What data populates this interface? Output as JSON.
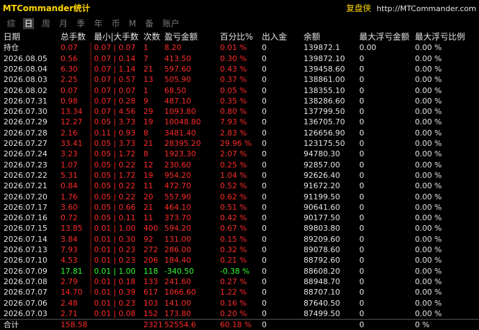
{
  "title": {
    "app": "MTCommander统计",
    "brand": "复盘侠",
    "site": "http://MTCommander.com"
  },
  "tabs": [
    "综",
    "日",
    "周",
    "月",
    "季",
    "年",
    "币",
    "M",
    "备",
    "账户"
  ],
  "active_tab": 1,
  "columns": [
    "日期",
    "总手数",
    "最小|大手数",
    "次数",
    "盈亏金额",
    "百分比%",
    "出入金",
    "余额",
    "最大浮亏金额",
    "最大浮亏比例"
  ],
  "holding": {
    "label": "持仓",
    "lots": "0.07",
    "minmax": "0.07 | 0.07",
    "count": "1",
    "pnl": "8.20",
    "pct": "0.01 %",
    "inout": "0",
    "balance": "139872.1",
    "maxfloat": "0.00",
    "maxfloat_pct": "0.00 %"
  },
  "rows": [
    {
      "date": "2026.08.05",
      "lots": "0.56",
      "minmax": "0.07 | 0.14",
      "count": "7",
      "pnl": "413.50",
      "pct": "0.30 %",
      "inout": "0",
      "balance": "139872.10",
      "maxfloat": "0",
      "maxfloat_pct": "0.00 %",
      "dir": "up"
    },
    {
      "date": "2026.08.04",
      "lots": "6.30",
      "minmax": "0.07 | 1.14",
      "count": "21",
      "pnl": "597.60",
      "pct": "0.43 %",
      "inout": "0",
      "balance": "139458.60",
      "maxfloat": "0",
      "maxfloat_pct": "0.00 %",
      "dir": "up"
    },
    {
      "date": "2026.08.03",
      "lots": "2.25",
      "minmax": "0.07 | 0.57",
      "count": "13",
      "pnl": "505.90",
      "pct": "0.37 %",
      "inout": "0",
      "balance": "138861.00",
      "maxfloat": "0",
      "maxfloat_pct": "0.00 %",
      "dir": "up"
    },
    {
      "date": "2026.08.02",
      "lots": "0.07",
      "minmax": "0.07 | 0.07",
      "count": "1",
      "pnl": "68.50",
      "pct": "0.05 %",
      "inout": "0",
      "balance": "138355.10",
      "maxfloat": "0",
      "maxfloat_pct": "0.00 %",
      "dir": "up"
    },
    {
      "date": "2026.07.31",
      "lots": "0.98",
      "minmax": "0.07 | 0.28",
      "count": "9",
      "pnl": "487.10",
      "pct": "0.35 %",
      "inout": "0",
      "balance": "138286.60",
      "maxfloat": "0",
      "maxfloat_pct": "0.00 %",
      "dir": "up"
    },
    {
      "date": "2026.07.30",
      "lots": "13.34",
      "minmax": "0.07 | 4.56",
      "count": "29",
      "pnl": "1093.80",
      "pct": "0.80 %",
      "inout": "0",
      "balance": "137799.50",
      "maxfloat": "0",
      "maxfloat_pct": "0.00 %",
      "dir": "up"
    },
    {
      "date": "2026.07.29",
      "lots": "12.27",
      "minmax": "0.05 | 3.73",
      "count": "19",
      "pnl": "10048.80",
      "pct": "7.93 %",
      "inout": "0",
      "balance": "136705.70",
      "maxfloat": "0",
      "maxfloat_pct": "0.00 %",
      "dir": "up"
    },
    {
      "date": "2026.07.28",
      "lots": "2.16",
      "minmax": "0.11 | 0.93",
      "count": "8",
      "pnl": "3481.40",
      "pct": "2.83 %",
      "inout": "0",
      "balance": "126656.90",
      "maxfloat": "0",
      "maxfloat_pct": "0.00 %",
      "dir": "up"
    },
    {
      "date": "2026.07.27",
      "lots": "33.41",
      "minmax": "0.05 | 3.73",
      "count": "21",
      "pnl": "28395.20",
      "pct": "29.96 %",
      "inout": "0",
      "balance": "123175.50",
      "maxfloat": "0",
      "maxfloat_pct": "0.00 %",
      "dir": "up"
    },
    {
      "date": "2026.07.24",
      "lots": "3.23",
      "minmax": "0.05 | 1.72",
      "count": "8",
      "pnl": "1923.30",
      "pct": "2.07 %",
      "inout": "0",
      "balance": "94780.30",
      "maxfloat": "0",
      "maxfloat_pct": "0.00 %",
      "dir": "up"
    },
    {
      "date": "2026.07.23",
      "lots": "1.07",
      "minmax": "0.05 | 0.22",
      "count": "12",
      "pnl": "230.60",
      "pct": "0.25 %",
      "inout": "0",
      "balance": "92857.00",
      "maxfloat": "0",
      "maxfloat_pct": "0.00 %",
      "dir": "up"
    },
    {
      "date": "2026.07.22",
      "lots": "5.31",
      "minmax": "0.05 | 1.72",
      "count": "19",
      "pnl": "954.20",
      "pct": "1.04 %",
      "inout": "0",
      "balance": "92626.40",
      "maxfloat": "0",
      "maxfloat_pct": "0.00 %",
      "dir": "up"
    },
    {
      "date": "2026.07.21",
      "lots": "0.84",
      "minmax": "0.05 | 0.22",
      "count": "11",
      "pnl": "472.70",
      "pct": "0.52 %",
      "inout": "0",
      "balance": "91672.20",
      "maxfloat": "0",
      "maxfloat_pct": "0.00 %",
      "dir": "up"
    },
    {
      "date": "2026.07.20",
      "lots": "1.76",
      "minmax": "0.05 | 0.22",
      "count": "20",
      "pnl": "557.90",
      "pct": "0.62 %",
      "inout": "0",
      "balance": "91199.50",
      "maxfloat": "0",
      "maxfloat_pct": "0.00 %",
      "dir": "up"
    },
    {
      "date": "2026.07.17",
      "lots": "3.60",
      "minmax": "0.05 | 0.66",
      "count": "21",
      "pnl": "464.10",
      "pct": "0.51 %",
      "inout": "0",
      "balance": "90641.60",
      "maxfloat": "0",
      "maxfloat_pct": "0.00 %",
      "dir": "up"
    },
    {
      "date": "2026.07.16",
      "lots": "0.72",
      "minmax": "0.05 | 0.11",
      "count": "11",
      "pnl": "373.70",
      "pct": "0.42 %",
      "inout": "0",
      "balance": "90177.50",
      "maxfloat": "0",
      "maxfloat_pct": "0.00 %",
      "dir": "up"
    },
    {
      "date": "2026.07.15",
      "lots": "13.85",
      "minmax": "0.01 | 1.00",
      "count": "400",
      "pnl": "594.20",
      "pct": "0.67 %",
      "inout": "0",
      "balance": "89803.80",
      "maxfloat": "0",
      "maxfloat_pct": "0.00 %",
      "dir": "up"
    },
    {
      "date": "2026.07.14",
      "lots": "3.84",
      "minmax": "0.01 | 0.30",
      "count": "92",
      "pnl": "131.00",
      "pct": "0.15 %",
      "inout": "0",
      "balance": "89209.60",
      "maxfloat": "0",
      "maxfloat_pct": "0.00 %",
      "dir": "up"
    },
    {
      "date": "2026.07.13",
      "lots": "7.93",
      "minmax": "0.01 | 0.23",
      "count": "272",
      "pnl": "286.00",
      "pct": "0.32 %",
      "inout": "0",
      "balance": "89078.60",
      "maxfloat": "0",
      "maxfloat_pct": "0.00 %",
      "dir": "up"
    },
    {
      "date": "2026.07.10",
      "lots": "4.53",
      "minmax": "0.01 | 0.23",
      "count": "206",
      "pnl": "184.40",
      "pct": "0.21 %",
      "inout": "0",
      "balance": "88792.60",
      "maxfloat": "0",
      "maxfloat_pct": "0.00 %",
      "dir": "up"
    },
    {
      "date": "2026.07.09",
      "lots": "17.81",
      "minmax": "0.01 | 1.00",
      "count": "118",
      "pnl": "-340.50",
      "pct": "-0.38 %",
      "inout": "0",
      "balance": "88608.20",
      "maxfloat": "0",
      "maxfloat_pct": "0.00 %",
      "dir": "down"
    },
    {
      "date": "2026.07.08",
      "lots": "2.79",
      "minmax": "0.01 | 0.18",
      "count": "133",
      "pnl": "241.60",
      "pct": "0.27 %",
      "inout": "0",
      "balance": "88948.70",
      "maxfloat": "0",
      "maxfloat_pct": "0.00 %",
      "dir": "up"
    },
    {
      "date": "2026.07.07",
      "lots": "14.70",
      "minmax": "0.01 | 0.39",
      "count": "617",
      "pnl": "1066.60",
      "pct": "1.22 %",
      "inout": "0",
      "balance": "88707.10",
      "maxfloat": "0",
      "maxfloat_pct": "0.00 %",
      "dir": "up"
    },
    {
      "date": "2026.07.06",
      "lots": "2.48",
      "minmax": "0.01 | 0.23",
      "count": "103",
      "pnl": "141.00",
      "pct": "0.16 %",
      "inout": "0",
      "balance": "87640.50",
      "maxfloat": "0",
      "maxfloat_pct": "0.00 %",
      "dir": "up"
    },
    {
      "date": "2026.07.03",
      "lots": "2.71",
      "minmax": "0.01 | 0.08",
      "count": "152",
      "pnl": "173.80",
      "pct": "0.20 %",
      "inout": "0",
      "balance": "87499.50",
      "maxfloat": "0",
      "maxfloat_pct": "0.00 %",
      "dir": "up"
    }
  ],
  "total": {
    "label": "合计",
    "lots": "158.58",
    "minmax": "",
    "count": "2321",
    "pnl": "52554.6",
    "pct": "60.18 %",
    "inout": "0",
    "balance": "",
    "maxfloat": "0",
    "maxfloat_pct": "0 %"
  },
  "colors": {
    "profit": "#ff2a2a",
    "loss": "#33ff33",
    "title": "#ffd700",
    "background": "#000000"
  }
}
